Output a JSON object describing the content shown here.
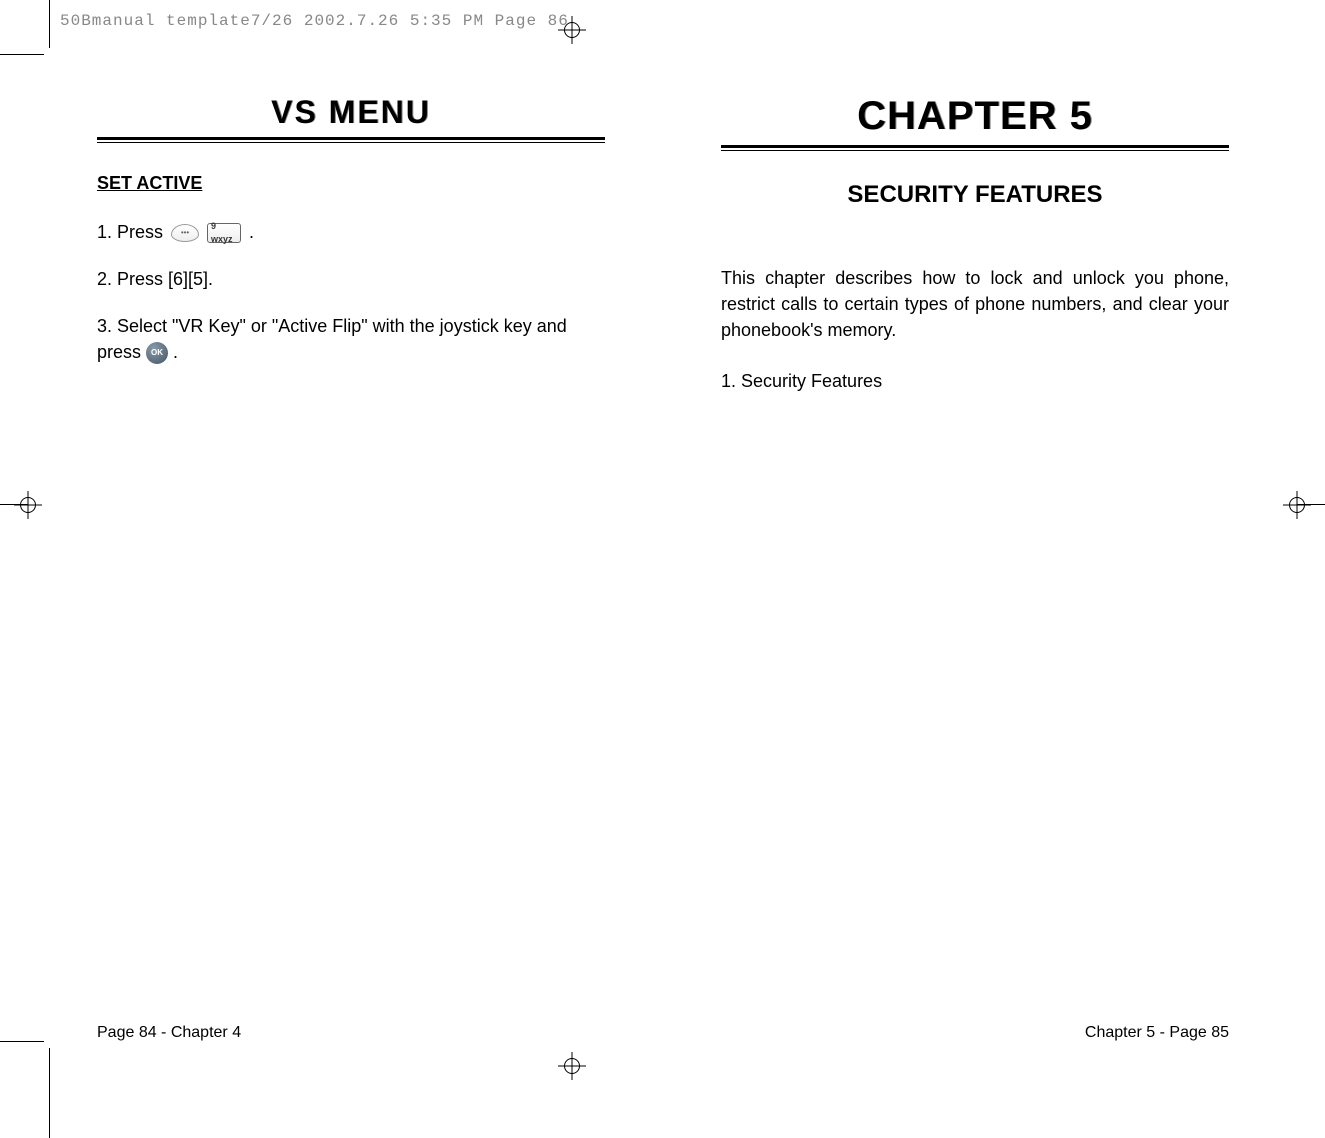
{
  "header": {
    "printInfo": "50Bmanual template7/26  2002.7.26  5:35 PM  Page 86"
  },
  "leftPage": {
    "title": "VS MENU",
    "section": "SET ACTIVE",
    "step1_prefix": "1. Press  ",
    "step1_suffix": " .",
    "step2": "2. Press [6][5].",
    "step3_prefix": "3. Select \"VR Key\" or \"Active Flip\" with the joystick key and press ",
    "step3_suffix": ".",
    "footer": "Page 84 - Chapter 4"
  },
  "rightPage": {
    "title": "CHAPTER 5",
    "subtitle": "SECURITY FEATURES",
    "body": "This chapter describes how to lock and unlock you phone, restrict calls to certain types of phone numbers, and clear your phonebook's memory.",
    "list1_num": "1.",
    "list1_text": " Security Features",
    "footer": "Chapter 5 - Page 85"
  },
  "icons": {
    "softkey": "•••",
    "nineKey": "9 wxyz",
    "okKey": "OK"
  }
}
